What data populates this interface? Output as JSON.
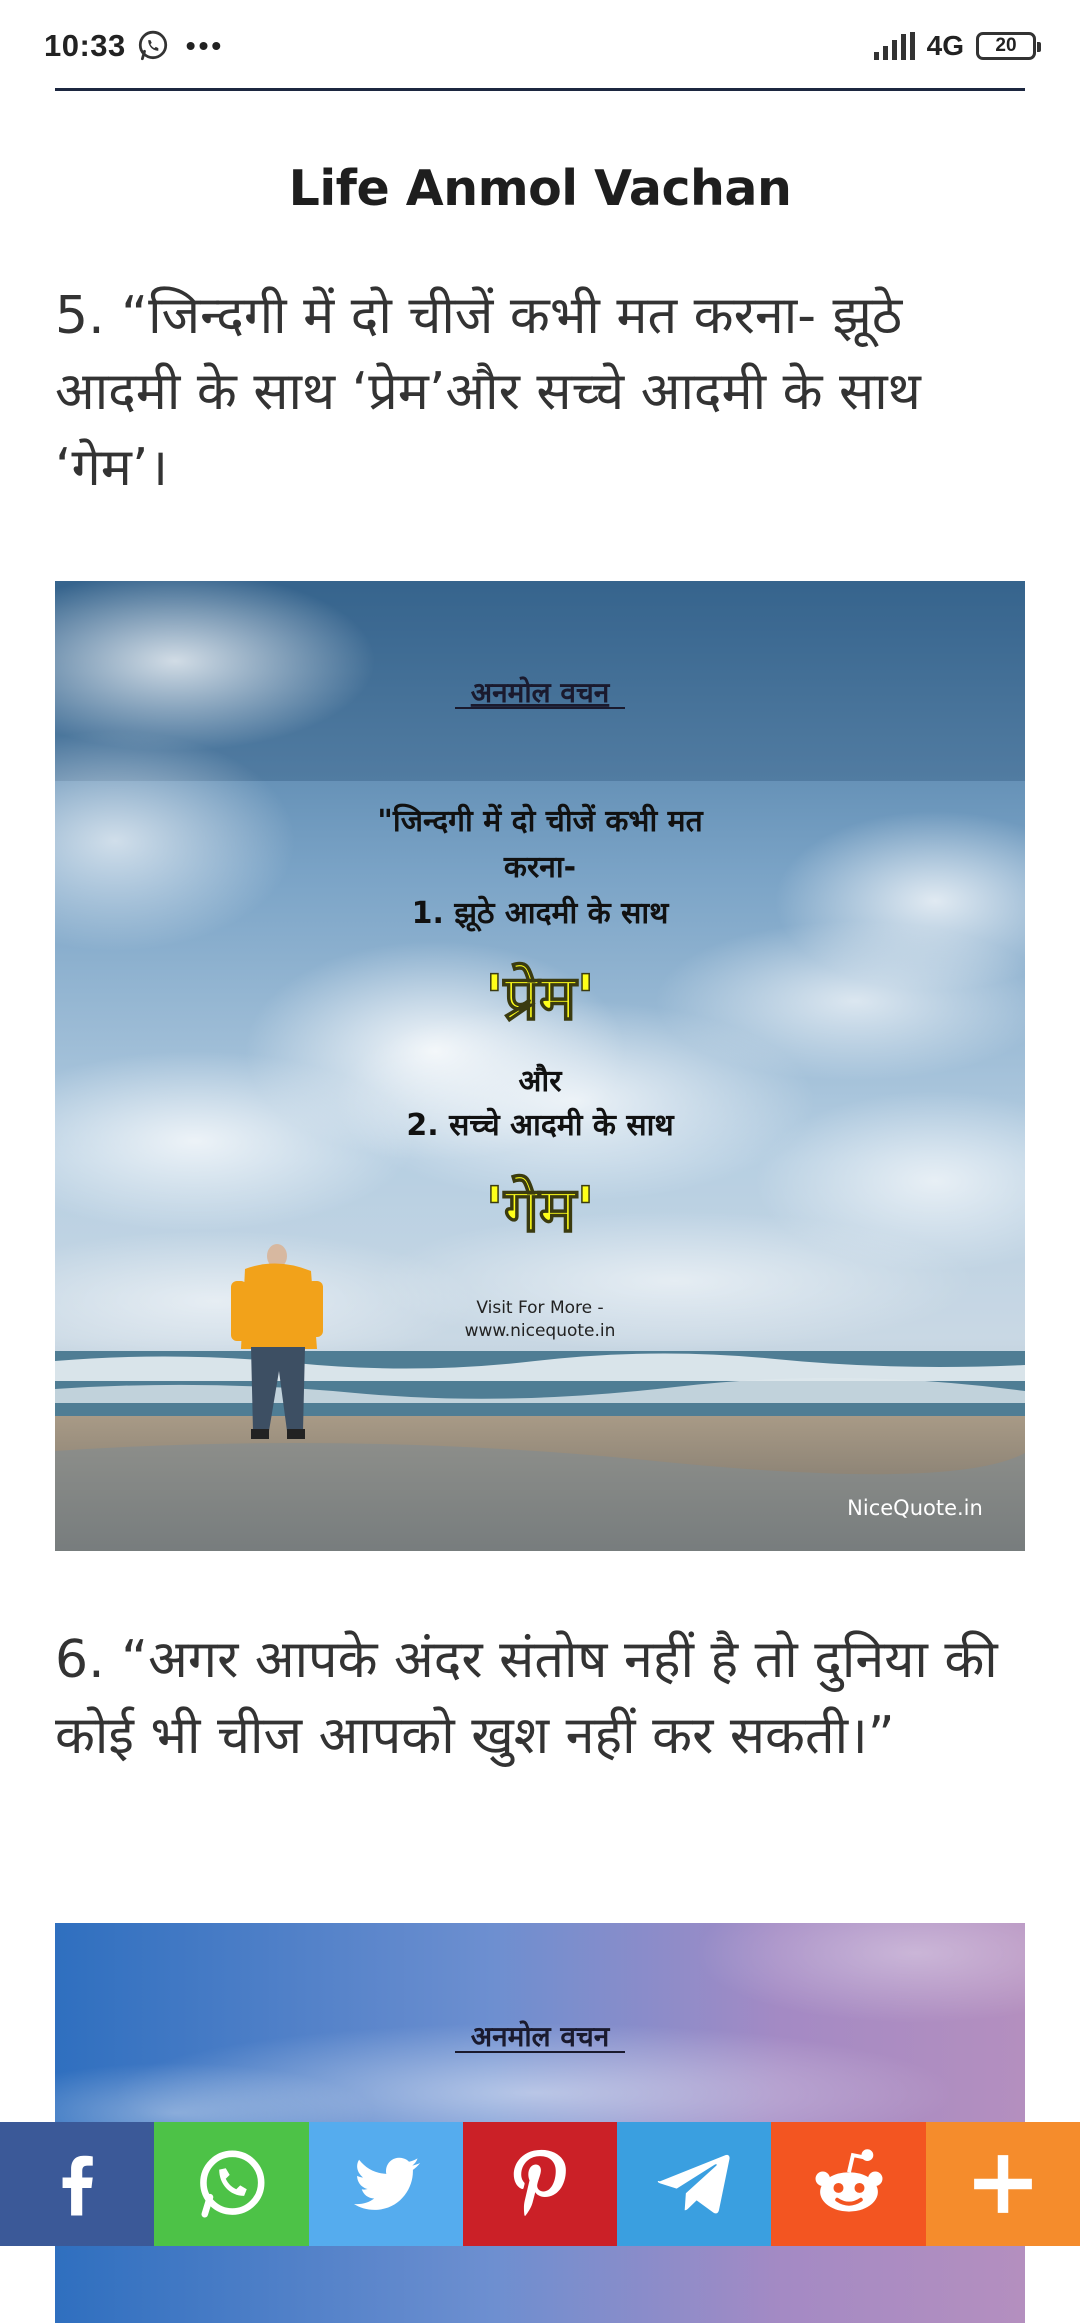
{
  "status_bar": {
    "time": "10:33",
    "overflow": "•••",
    "network": "4G",
    "battery": "20",
    "icons": [
      "whatsapp-icon",
      "signal-icon",
      "battery-icon"
    ]
  },
  "article": {
    "title": "Life Anmol Vachan",
    "quote_5": "5. “जिन्दगी में दो चीजें कभी मत करना- झूठे आदमी के साथ ‘प्रेम’और सच्चे आदमी के साथ ‘गेम’।",
    "quote_6": "6. “अगर आपके अंदर संतोष नहीं है तो दुनिया की कोई भी चीज आपको खुश नहीं कर सकती।”"
  },
  "image_1": {
    "heading": "अनमोल वचन",
    "line1": "\"जिन्दगी में दो चीजें कभी मत",
    "line2": "करना-",
    "line3": "1. झूठे आदमी के साथ",
    "highlight1": "'प्रेम'",
    "line4": "और",
    "line5": "2. सच्चे आदमी के साथ",
    "highlight2": "'गेम'",
    "visit": "Visit For More -",
    "site": "www.nicequote.in",
    "watermark": "NiceQuote.in"
  },
  "image_2": {
    "heading": "अनमोल वचन"
  },
  "share_bar": {
    "buttons": [
      {
        "name": "facebook",
        "color": "#3b5998",
        "icon": "facebook-icon"
      },
      {
        "name": "whatsapp",
        "color": "#4dc247",
        "icon": "whatsapp-icon"
      },
      {
        "name": "twitter",
        "color": "#55acee",
        "icon": "twitter-icon"
      },
      {
        "name": "pinterest",
        "color": "#cb2027",
        "icon": "pinterest-icon"
      },
      {
        "name": "telegram",
        "color": "#3a9fe0",
        "icon": "telegram-icon"
      },
      {
        "name": "reddit",
        "color": "#f35521",
        "icon": "reddit-icon"
      },
      {
        "name": "more",
        "color": "#f58c2c",
        "icon": "plus-icon"
      }
    ]
  }
}
